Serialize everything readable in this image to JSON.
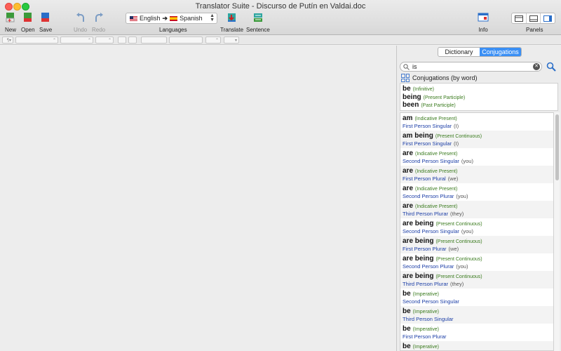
{
  "window": {
    "title": "Translator Suite - Discurso de Putín en Valdai.doc"
  },
  "toolbar": {
    "new": "New",
    "open": "Open",
    "save": "Save",
    "undo": "Undo",
    "redo": "Redo",
    "languages": "Languages",
    "lang_from": "English",
    "lang_to": "Spanish",
    "translate": "Translate",
    "sentence": "Sentence",
    "info": "Info",
    "panels": "Panels"
  },
  "side": {
    "tabs": [
      "Dictionary",
      "Conjugations"
    ],
    "active_tab": "Conjugations",
    "search_value": "is",
    "mode_label": "Conjugations (by word)",
    "infinitives": [
      {
        "word": "be",
        "tense": "(Infinitive)"
      },
      {
        "word": "being",
        "tense": "(Present Participle)"
      },
      {
        "word": "been",
        "tense": "(Past Participle)"
      }
    ],
    "items": [
      {
        "word": "am",
        "tense": "(Indicative Present)",
        "person": "First Person Singular",
        "pronoun": "(I)"
      },
      {
        "word": "am being",
        "tense": "(Present Continuous)",
        "person": "First Person Singular",
        "pronoun": "(I)"
      },
      {
        "word": "are",
        "tense": "(Indicative Present)",
        "person": "Second Person Singular",
        "pronoun": "(you)"
      },
      {
        "word": "are",
        "tense": "(Indicative Present)",
        "person": "First Person Plural",
        "pronoun": "(we)"
      },
      {
        "word": "are",
        "tense": "(Indicative Present)",
        "person": "Second Person Plurar",
        "pronoun": "(you)"
      },
      {
        "word": "are",
        "tense": "(Indicative Present)",
        "person": "Third Person Plurar",
        "pronoun": "(they)"
      },
      {
        "word": "are being",
        "tense": "(Present Continuous)",
        "person": "Second Person Singular",
        "pronoun": "(you)"
      },
      {
        "word": "are being",
        "tense": "(Present Continuous)",
        "person": "First Person Plurar",
        "pronoun": "(we)"
      },
      {
        "word": "are being",
        "tense": "(Present Continuous)",
        "person": "Second Person Plurar",
        "pronoun": "(you)"
      },
      {
        "word": "are being",
        "tense": "(Present Continuous)",
        "person": "Third Person Plurar",
        "pronoun": "(they)"
      },
      {
        "word": "be",
        "tense": "(Imperative)",
        "person": "Second Person Singular",
        "pronoun": ""
      },
      {
        "word": "be",
        "tense": "(Imperative)",
        "person": "Third Person Singular",
        "pronoun": ""
      },
      {
        "word": "be",
        "tense": "(Imperative)",
        "person": "First Person Plurar",
        "pronoun": ""
      },
      {
        "word": "be",
        "tense": "(Imperative)",
        "person": "",
        "pronoun": ""
      }
    ]
  },
  "colors": {
    "accent": "#3a8ff5",
    "tense": "#3a7b1e",
    "person": "#1a3da6"
  }
}
